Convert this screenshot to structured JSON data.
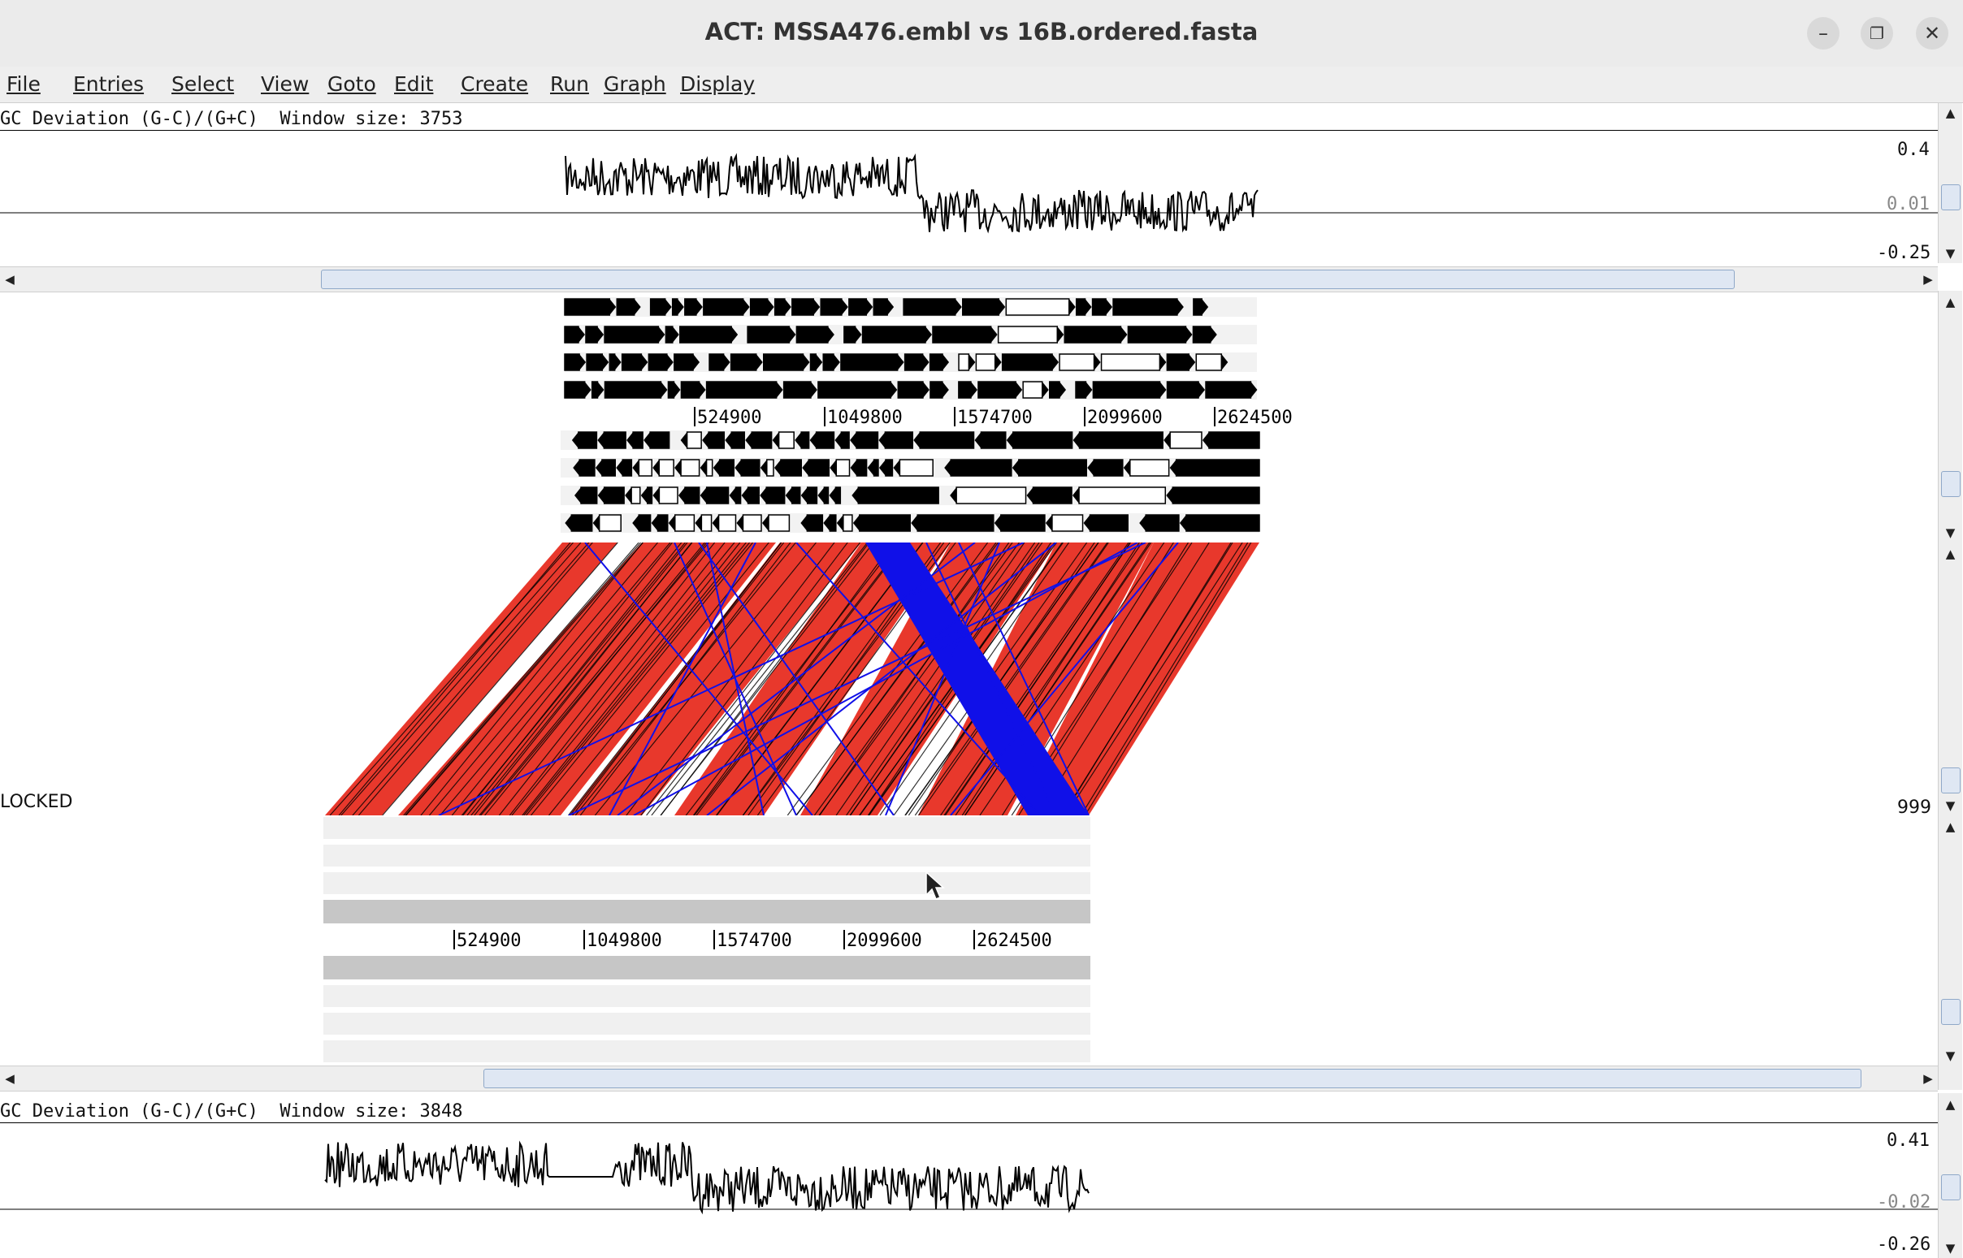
{
  "window": {
    "title": "ACT: MSSA476.embl vs 16B.ordered.fasta"
  },
  "menu": [
    "File",
    "Entries",
    "Select",
    "View",
    "Goto",
    "Edit",
    "Create",
    "Run",
    "Graph",
    "Display"
  ],
  "top_graph": {
    "label": "GC Deviation (G-C)/(G+C)  Window size: 3753",
    "max": "0.4",
    "mid": "0.01",
    "min": "-0.25"
  },
  "top_ruler": [
    "524900",
    "1049800",
    "1574700",
    "2099600",
    "2624500"
  ],
  "comparison": {
    "lock_label": "LOCKED",
    "score": "999"
  },
  "bottom_ruler": [
    "524900",
    "1049800",
    "1574700",
    "2099600",
    "2624500"
  ],
  "bottom_graph": {
    "label": "GC Deviation (G-C)/(G+C)  Window size: 3848",
    "max": "0.41",
    "mid": "-0.02",
    "min": "-0.26"
  },
  "colors": {
    "forward_match": "#e8382c",
    "reverse_match": "#1010e8",
    "graph_line": "#000000"
  }
}
